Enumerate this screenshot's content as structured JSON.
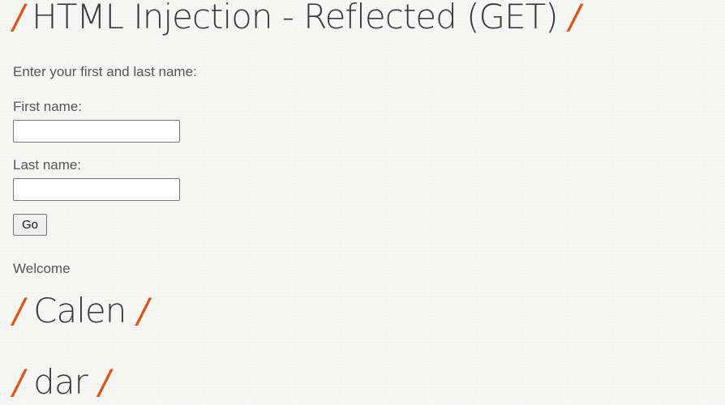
{
  "header": {
    "slash_left": "/",
    "title": "HTML Injection - Reflected (GET)",
    "slash_right": "/"
  },
  "form": {
    "prompt": "Enter your first and last name:",
    "first_name_label": "First name:",
    "first_name_value": "",
    "last_name_label": "Last name:",
    "last_name_value": "",
    "submit_label": "Go"
  },
  "result": {
    "welcome_text": "Welcome",
    "injected_headings": [
      {
        "slash_left": "/",
        "text": "Calen",
        "slash_right": "/"
      },
      {
        "slash_left": "/",
        "text": "dar",
        "slash_right": "/"
      }
    ]
  },
  "colors": {
    "accent_slash": "#e35314",
    "heading_text": "#3b3b3b",
    "body_text": "#555555",
    "background": "#f6f6f5"
  }
}
